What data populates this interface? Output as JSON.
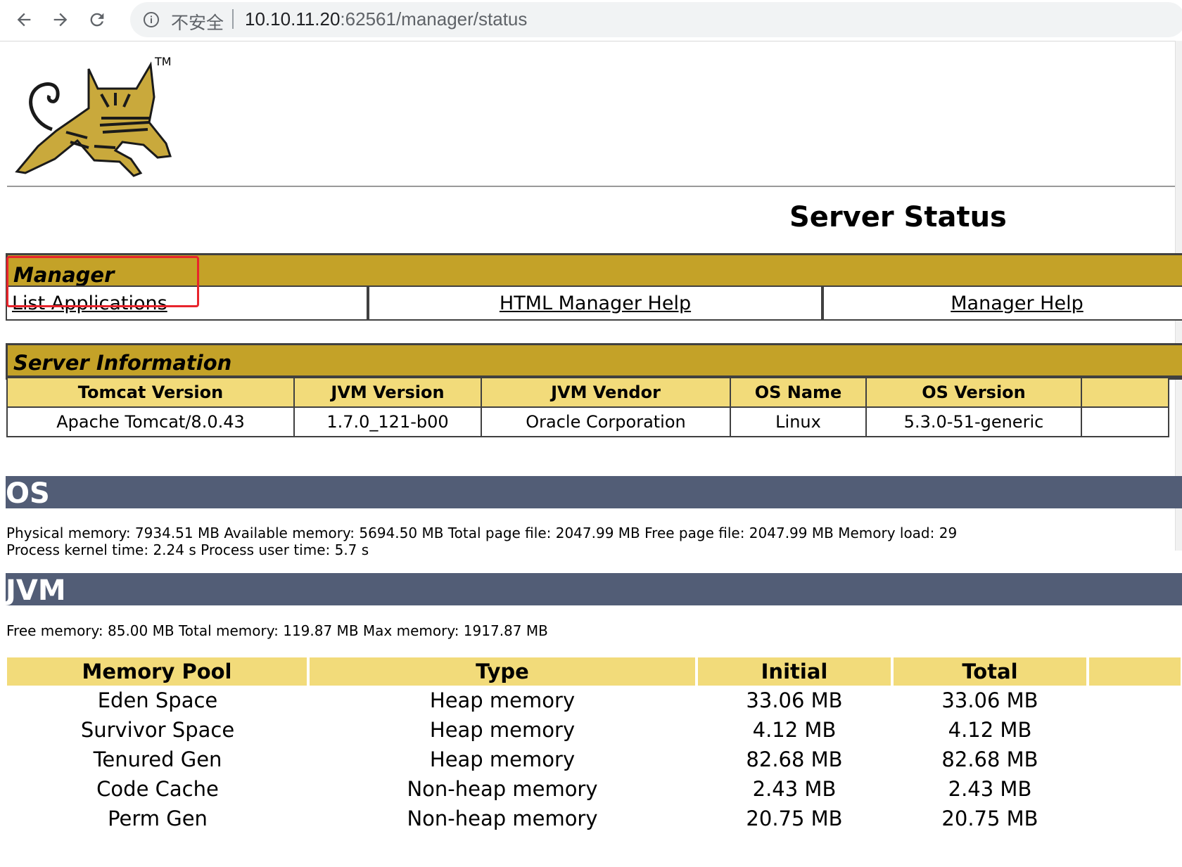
{
  "browser": {
    "security_label": "不安全",
    "url_host": "10.10.11.20",
    "url_rest": ":62561/manager/status"
  },
  "page": {
    "title": "Server Status",
    "logo_tm": "TM"
  },
  "manager": {
    "heading": "Manager",
    "links": [
      "List Applications",
      "HTML Manager Help",
      "Manager Help"
    ]
  },
  "server_info": {
    "heading": "Server Information",
    "columns": [
      "Tomcat Version",
      "JVM Version",
      "JVM Vendor",
      "OS Name",
      "OS Version"
    ],
    "values": [
      "Apache Tomcat/8.0.43",
      "1.7.0_121-b00",
      "Oracle Corporation",
      "Linux",
      "5.3.0-51-generic"
    ]
  },
  "os": {
    "heading": "OS",
    "line1": "Physical memory: 7934.51 MB Available memory: 5694.50 MB Total page file: 2047.99 MB Free page file: 2047.99 MB Memory load: 29",
    "line2": "Process kernel time: 2.24 s Process user time: 5.7 s"
  },
  "jvm": {
    "heading": "JVM",
    "line1": "Free memory: 85.00 MB Total memory: 119.87 MB Max memory: 1917.87 MB",
    "columns": [
      "Memory Pool",
      "Type",
      "Initial",
      "Total"
    ],
    "rows": [
      [
        "Eden Space",
        "Heap memory",
        "33.06 MB",
        "33.06 MB"
      ],
      [
        "Survivor Space",
        "Heap memory",
        "4.12 MB",
        "4.12 MB"
      ],
      [
        "Tenured Gen",
        "Heap memory",
        "82.68 MB",
        "82.68 MB"
      ],
      [
        "Code Cache",
        "Non-heap memory",
        "2.43 MB",
        "2.43 MB"
      ],
      [
        "Perm Gen",
        "Non-heap memory",
        "20.75 MB",
        "20.75 MB"
      ]
    ]
  },
  "colors": {
    "manager_header": "#c4a228",
    "column_header": "#f2db7a",
    "section_bar": "#525d76",
    "highlight": "#e8242c"
  }
}
